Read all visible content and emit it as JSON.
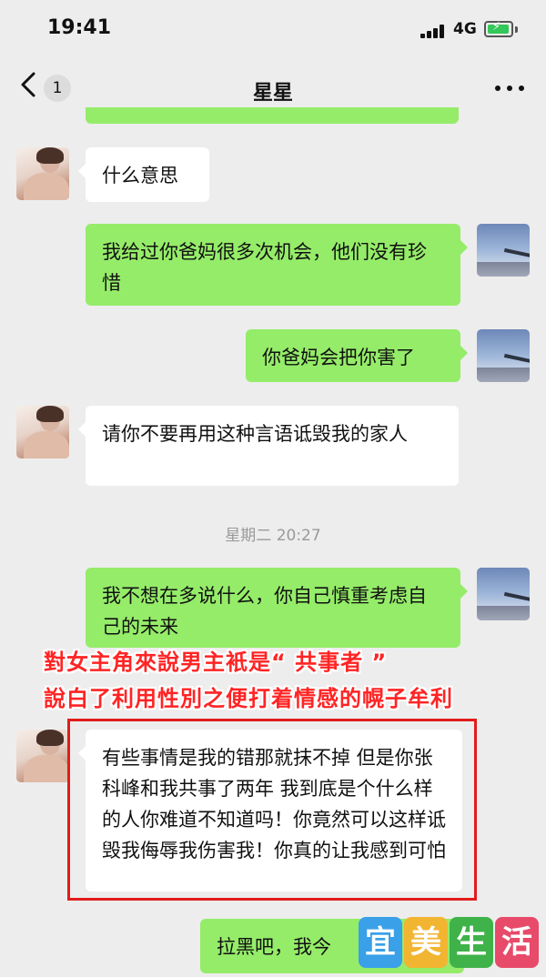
{
  "status_bar": {
    "time": "19:41",
    "network": "4G"
  },
  "nav": {
    "back_icon": "chevron-left-icon",
    "unread_count": "1",
    "title": "星星",
    "more_icon": "ellipsis-icon"
  },
  "messages": [
    {
      "side": "in",
      "text": "什么意思"
    },
    {
      "side": "out",
      "text": "我给过你爸妈很多次机会，他们没有珍惜"
    },
    {
      "side": "out",
      "text": "你爸妈会把你害了"
    },
    {
      "side": "in",
      "text": "请你不要再用这种言语诋毁我的家人"
    },
    {
      "side": "out",
      "text": "我不想在多说什么，你自己慎重考虑自己的未来"
    },
    {
      "side": "in",
      "text": "有些事情是我的错那就抹不掉 但是你张科峰和我共事了两年 我到底是个什么样的人你难道不知道吗！你竟然可以这样诋毁我侮辱我伤害我！你真的让我感到可怕"
    },
    {
      "side": "out",
      "text": "拉黑吧，我今"
    }
  ],
  "time_divider": "星期二 20:27",
  "caption": {
    "line1": "對女主角來說男主衹是“ 共事者 ”",
    "line2": "說白了利用性別之便打着情感的幌子牟利",
    "color": "#ff2424"
  },
  "highlight_color": "#e21c1c",
  "watermark": {
    "chars": [
      "宜",
      "美",
      "生",
      "活"
    ],
    "colors": [
      "#3aa0e8",
      "#f2b531",
      "#3fb24a",
      "#e84a6a"
    ]
  }
}
